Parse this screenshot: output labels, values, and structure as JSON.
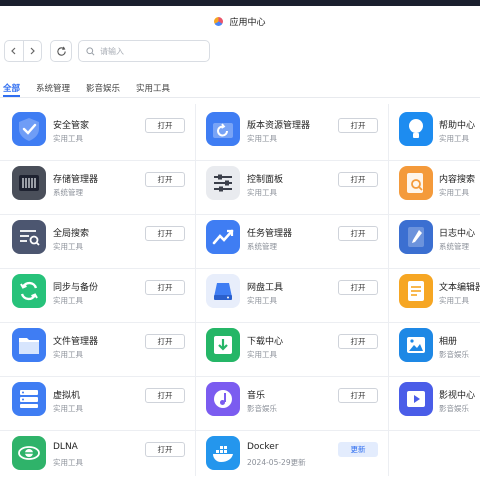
{
  "window": {
    "title": "应用中心"
  },
  "toolbar": {
    "search_placeholder": "请输入"
  },
  "tabs": [
    {
      "label": "全部",
      "active": true
    },
    {
      "label": "系统管理",
      "active": false
    },
    {
      "label": "影音娱乐",
      "active": false
    },
    {
      "label": "实用工具",
      "active": false
    }
  ],
  "apps": [
    {
      "name": "安全管家",
      "sub": "实用工具",
      "action": "打开",
      "icon": "shield-check-icon",
      "color": "#3f7df3"
    },
    {
      "name": "版本资源管理器",
      "sub": "实用工具",
      "action": "打开",
      "icon": "folder-restore-icon",
      "color": "#3f7df3"
    },
    {
      "name": "帮助中心",
      "sub": "实用工具",
      "action": "",
      "icon": "lightbulb-icon",
      "color": "#1d8cf0"
    },
    {
      "name": "存储管理器",
      "sub": "系统管理",
      "action": "打开",
      "icon": "disk-array-icon",
      "color": "#4a4f5a"
    },
    {
      "name": "控制面板",
      "sub": "实用工具",
      "action": "打开",
      "icon": "sliders-icon",
      "color": "#e9ebef"
    },
    {
      "name": "内容搜索",
      "sub": "实用工具",
      "action": "",
      "icon": "document-search-icon",
      "color": "#f49a3b"
    },
    {
      "name": "全局搜索",
      "sub": "实用工具",
      "action": "打开",
      "icon": "global-search-icon",
      "color": "#4c5670"
    },
    {
      "name": "任务管理器",
      "sub": "系统管理",
      "action": "打开",
      "icon": "trend-chart-icon",
      "color": "#3f7df3"
    },
    {
      "name": "日志中心",
      "sub": "系统管理",
      "action": "",
      "icon": "log-book-icon",
      "color": "#3b6fd1"
    },
    {
      "name": "同步与备份",
      "sub": "实用工具",
      "action": "打开",
      "icon": "sync-icon",
      "color": "#27c27a"
    },
    {
      "name": "网盘工具",
      "sub": "实用工具",
      "action": "打开",
      "icon": "cloud-drive-icon",
      "color": "#e8eefb"
    },
    {
      "name": "文本编辑器",
      "sub": "实用工具",
      "action": "",
      "icon": "text-editor-icon",
      "color": "#f6a623"
    },
    {
      "name": "文件管理器",
      "sub": "实用工具",
      "action": "打开",
      "icon": "folder-icon",
      "color": "#3f7df3"
    },
    {
      "name": "下载中心",
      "sub": "实用工具",
      "action": "打开",
      "icon": "download-icon",
      "color": "#25b667"
    },
    {
      "name": "相册",
      "sub": "影音娱乐",
      "action": "",
      "icon": "photo-icon",
      "color": "#1e88e5"
    },
    {
      "name": "虚拟机",
      "sub": "实用工具",
      "action": "打开",
      "icon": "server-icon",
      "color": "#3f7df3"
    },
    {
      "name": "音乐",
      "sub": "影音娱乐",
      "action": "打开",
      "icon": "music-icon",
      "color": "#7b5cf0"
    },
    {
      "name": "影视中心",
      "sub": "影音娱乐",
      "action": "",
      "icon": "video-play-icon",
      "color": "#4a5de8"
    },
    {
      "name": "DLNA",
      "sub": "实用工具",
      "action": "打开",
      "icon": "dlna-icon",
      "color": "#2fb36a"
    },
    {
      "name": "Docker",
      "sub": "2024-05-29更新",
      "action": "更新",
      "icon": "docker-whale-icon",
      "color": "#2496ed"
    }
  ]
}
